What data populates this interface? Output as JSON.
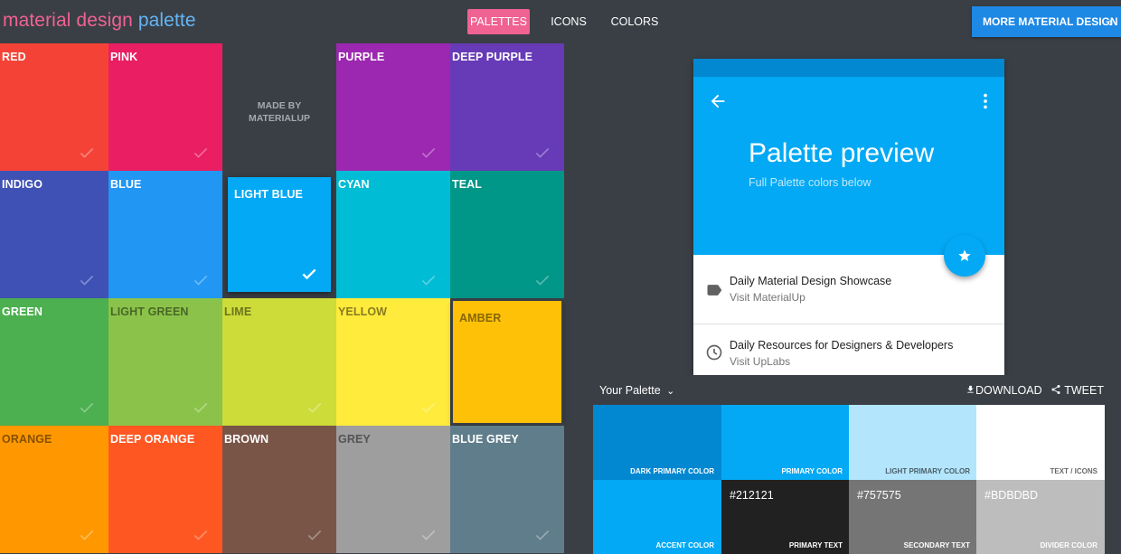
{
  "header": {
    "logo_part1": "material design",
    "logo_part2": "palette",
    "nav": [
      "PALETTES",
      "ICONS",
      "COLORS"
    ],
    "more_label": "MORE MATERIAL DESIGN",
    "more_icon": "chevron-right-icon",
    "accent": "#f06292",
    "logo_blue": "#64b5f6"
  },
  "palette_grid": {
    "tiles": [
      {
        "name": "RED",
        "color": "#f44336"
      },
      {
        "name": "PINK",
        "color": "#e91e63"
      },
      {
        "name": "PURPLE",
        "color": "#9c27b0"
      },
      {
        "name": "DEEP PURPLE",
        "color": "#673ab7"
      },
      {
        "name": "INDIGO",
        "color": "#3f51b5"
      },
      {
        "name": "BLUE",
        "color": "#2196f3"
      },
      {
        "name": "LIGHT BLUE",
        "color": "#03a9f4",
        "selected": true
      },
      {
        "name": "CYAN",
        "color": "#00bcd4"
      },
      {
        "name": "TEAL",
        "color": "#009688"
      },
      {
        "name": "GREEN",
        "color": "#4caf50"
      },
      {
        "name": "LIGHT GREEN",
        "color": "#8bc34a"
      },
      {
        "name": "LIME",
        "color": "#cddc39"
      },
      {
        "name": "YELLOW",
        "color": "#ffeb3b"
      },
      {
        "name": "AMBER",
        "color": "#ffc107",
        "selected": true
      },
      {
        "name": "ORANGE",
        "color": "#ff9800"
      },
      {
        "name": "DEEP ORANGE",
        "color": "#ff5722"
      },
      {
        "name": "BROWN",
        "color": "#795548"
      },
      {
        "name": "GREY",
        "color": "#9e9e9e"
      },
      {
        "name": "BLUE GREY",
        "color": "#607d8b"
      }
    ],
    "made_by_line1": "MADE BY",
    "made_by_line2": "MATERIALUP"
  },
  "preview": {
    "title": "Palette preview",
    "subtitle": "Full Palette colors below",
    "items": [
      {
        "title": "Daily Material Design Showcase",
        "subtitle": "Visit MaterialUp",
        "icon": "label-icon"
      },
      {
        "title": "Daily Resources for Designers & Developers",
        "subtitle": "Visit UpLabs",
        "icon": "clock-icon"
      }
    ]
  },
  "your_palette": {
    "title": "Your Palette",
    "download": "DOWNLOAD",
    "tweet": "TWEET",
    "swatches": [
      {
        "label": "DARK PRIMARY COLOR",
        "color": "#0288d1"
      },
      {
        "label": "PRIMARY COLOR",
        "color": "#03a9f4"
      },
      {
        "label": "LIGHT PRIMARY COLOR",
        "color": "#b3e5fc"
      },
      {
        "label": "TEXT / ICONS",
        "color": "#ffffff"
      },
      {
        "label": "ACCENT COLOR",
        "color": "#03a9f4"
      },
      {
        "label": "PRIMARY TEXT",
        "hex": "#212121",
        "color": "#212121"
      },
      {
        "label": "SECONDARY TEXT",
        "hex": "#757575",
        "color": "#757575"
      },
      {
        "label": "DIVIDER COLOR",
        "hex": "#BDBDBD",
        "color": "#bdbdbd"
      }
    ]
  }
}
